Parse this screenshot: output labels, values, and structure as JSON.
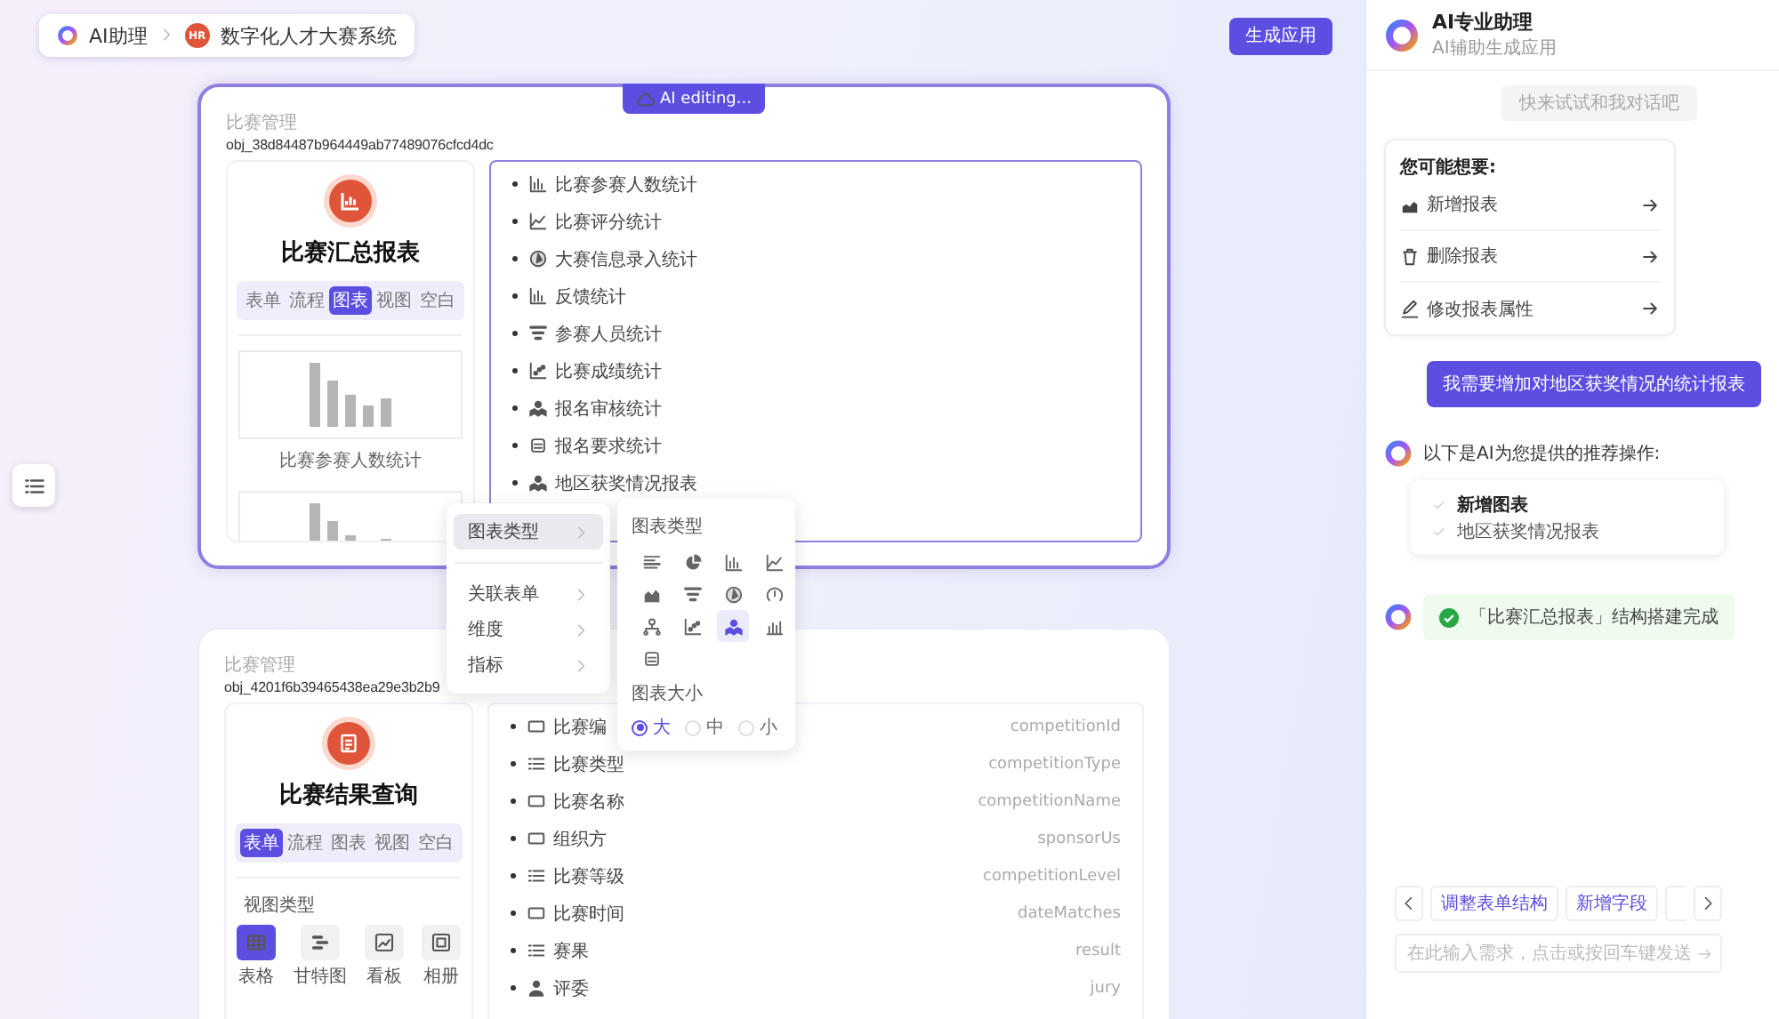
{
  "breadcrumb": [
    {
      "kind": "assistant",
      "label": "AI助理"
    },
    {
      "kind": "app",
      "badge": "HR",
      "label": "数字化人才大赛系统"
    }
  ],
  "generate_button": "生成应用",
  "cards": [
    {
      "active": true,
      "editing_badge": "AI editing...",
      "group": "比赛管理",
      "object_id": "obj_38d84487b964449ab77489076cfcd4dc",
      "kind": "chart",
      "title": "比赛汇总报表",
      "tabs": [
        {
          "label": "表单",
          "selected": false
        },
        {
          "label": "流程",
          "selected": false
        },
        {
          "label": "图表",
          "selected": true
        },
        {
          "label": "视图",
          "selected": false
        },
        {
          "label": "空白",
          "selected": false
        }
      ],
      "thumbnails": [
        {
          "kind": "bar",
          "caption": "比赛参赛人数统计"
        },
        {
          "kind": "bar"
        }
      ],
      "items": [
        {
          "kind": "bar",
          "label": "比赛参赛人数统计"
        },
        {
          "kind": "line",
          "label": "比赛评分统计"
        },
        {
          "kind": "radar",
          "label": "大赛信息录入统计"
        },
        {
          "kind": "bar",
          "label": "反馈统计"
        },
        {
          "kind": "funnel",
          "label": "参赛人员统计"
        },
        {
          "kind": "scatter",
          "label": "比赛成绩统计"
        },
        {
          "kind": "map",
          "label": "报名审核统计"
        },
        {
          "kind": "wave",
          "label": "报名要求统计"
        },
        {
          "kind": "map",
          "label": "地区获奖情况报表"
        }
      ]
    },
    {
      "active": false,
      "group": "比赛管理",
      "object_id": "obj_4201f6b39465438ea29e3b2b9",
      "kind": "form",
      "title": "比赛结果查询",
      "tabs": [
        {
          "label": "表单",
          "selected": true
        },
        {
          "label": "流程",
          "selected": false
        },
        {
          "label": "图表",
          "selected": false
        },
        {
          "label": "视图",
          "selected": false
        },
        {
          "label": "空白",
          "selected": false
        }
      ],
      "view_types_title": "视图类型",
      "view_types": [
        {
          "kind": "table",
          "label": "表格",
          "selected": true
        },
        {
          "kind": "gantt",
          "label": "甘特图",
          "selected": false
        },
        {
          "kind": "board",
          "label": "看板",
          "selected": false
        },
        {
          "kind": "album",
          "label": "相册",
          "selected": false
        }
      ],
      "items": [
        {
          "kind": "field",
          "label": "比赛编",
          "field": "competitionId"
        },
        {
          "kind": "list",
          "label": "比赛类型",
          "field": "competitionType"
        },
        {
          "kind": "field",
          "label": "比赛名称",
          "field": "competitionName"
        },
        {
          "kind": "field",
          "label": "组织方",
          "field": "sponsorUs"
        },
        {
          "kind": "list",
          "label": "比赛等级",
          "field": "competitionLevel"
        },
        {
          "kind": "field",
          "label": "比赛时间",
          "field": "dateMatches"
        },
        {
          "kind": "list",
          "label": "赛果",
          "field": "result"
        },
        {
          "kind": "person",
          "label": "评委",
          "field": "jury"
        }
      ]
    }
  ],
  "context_menu": {
    "groups": [
      [
        {
          "label": "图表类型",
          "selected": true
        }
      ],
      [
        {
          "label": "关联表单",
          "selected": false
        },
        {
          "label": "维度",
          "selected": false
        },
        {
          "label": "指标",
          "selected": false
        }
      ]
    ],
    "submenu": {
      "title": "图表类型",
      "chart_types": [
        {
          "kind": "number",
          "selected": false
        },
        {
          "kind": "pie",
          "selected": false
        },
        {
          "kind": "bar",
          "selected": false
        },
        {
          "kind": "line",
          "selected": false
        },
        {
          "kind": "area",
          "selected": false
        },
        {
          "kind": "funnel",
          "selected": false
        },
        {
          "kind": "radar",
          "selected": false
        },
        {
          "kind": "gauge",
          "selected": false
        },
        {
          "kind": "tree",
          "selected": false
        },
        {
          "kind": "scatter",
          "selected": false
        },
        {
          "kind": "map",
          "selected": true
        },
        {
          "kind": "histogram",
          "selected": false
        },
        {
          "kind": "wave",
          "selected": false
        }
      ],
      "size_title": "图表大小",
      "sizes": [
        {
          "label": "大",
          "selected": true
        },
        {
          "label": "中",
          "selected": false
        },
        {
          "label": "小",
          "selected": false
        }
      ]
    }
  },
  "assistant": {
    "title": "AI专业助理",
    "subtitle": "AI辅助生成应用",
    "hint": "快来试试和我对话吧",
    "suggestions": {
      "title": "您可能想要:",
      "items": [
        {
          "kind": "add",
          "label": "新增报表"
        },
        {
          "kind": "delete",
          "label": "删除报表"
        },
        {
          "kind": "edit",
          "label": "修改报表属性"
        }
      ]
    },
    "messages": [
      {
        "kind": "user",
        "text": "我需要增加对地区获奖情况的统计报表"
      },
      {
        "kind": "recommend",
        "text": "以下是AI为您提供的推荐操作:",
        "steps": [
          {
            "kind": "heading",
            "label": "新增图表"
          },
          {
            "kind": "item",
            "label": "地区获奖情况报表"
          }
        ]
      },
      {
        "kind": "status",
        "text": "「比赛汇总报表」结构搭建完成"
      }
    ],
    "quick_actions": [
      "调整表单结构",
      "新增字段"
    ],
    "input": {
      "placeholder": "在此输入需求，点击或按回车键发送"
    }
  }
}
